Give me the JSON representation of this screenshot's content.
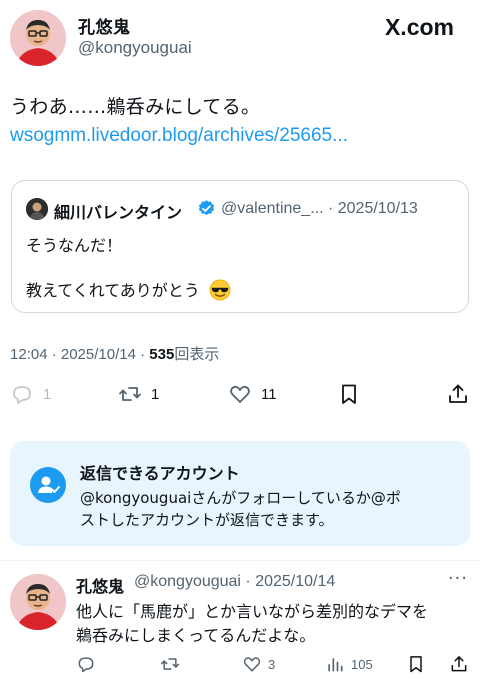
{
  "post": {
    "author_name": "孔悠鬼",
    "author_handle": "@kongyouguai",
    "site_logo": "X.com",
    "text": "うわあ……鵜呑みにしてる。",
    "link": "wsogmm.livedoor.blog/archives/25665...",
    "timestamp": "12:04 · 2025/10/14 · ",
    "views": "535",
    "views_label": "回表示",
    "actions": {
      "reply_count": "1",
      "repost_count": "1",
      "like_count": "11"
    }
  },
  "quote": {
    "name": "細川バレンタイン",
    "meta": "@valentine_... · 2025/10/13",
    "line1": "そうなんだ！",
    "line2": "教えてくれてありがとう",
    "emoji": "smiling-face-with-sunglasses"
  },
  "notice": {
    "title": "返信できるアカウント",
    "line1": "@kongyouguaiさんがフォローしているか@ポ",
    "line2": "ストしたアカウントが返信できます。"
  },
  "reply": {
    "name": "孔悠鬼",
    "meta": "@kongyouguai · 2025/10/14",
    "more": "···",
    "line1": "他人に「馬鹿が」とか言いながら差別的なデマを",
    "line2": "鵜呑みにしまくってるんだよな。",
    "actions": {
      "like_count": "3",
      "views_count": "105"
    }
  },
  "colors": {
    "accent": "#1d9bf0",
    "text": "#0f1419",
    "muted": "#536471",
    "notice_bg": "#e8f5fd"
  }
}
